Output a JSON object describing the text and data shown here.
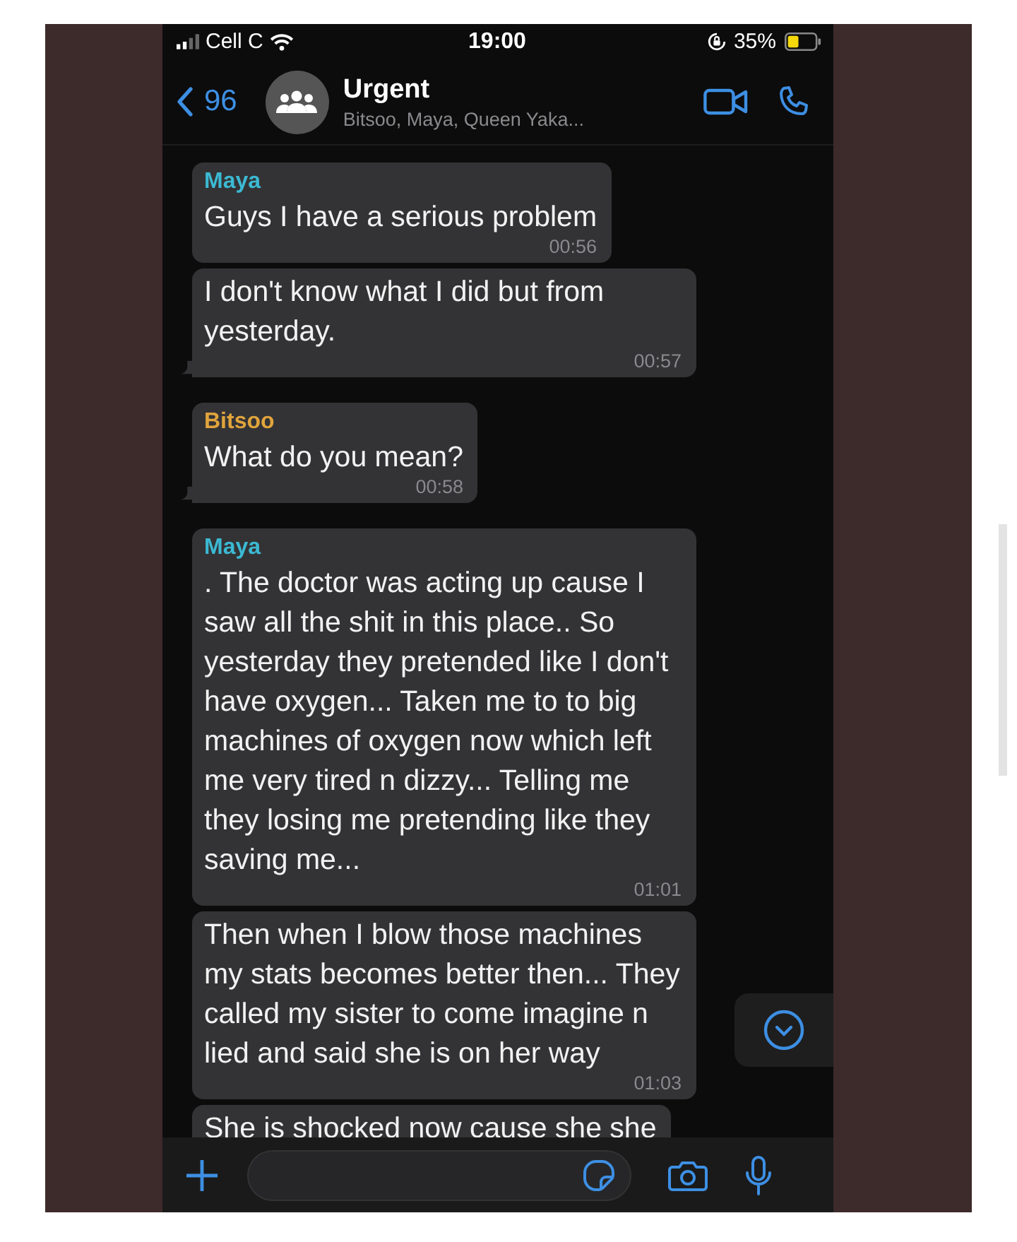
{
  "status_bar": {
    "carrier": "Cell C",
    "time": "19:00",
    "battery": "35%"
  },
  "header": {
    "back_count": "96",
    "title": "Urgent",
    "subtitle": "Bitsoo, Maya, Queen Yaka..."
  },
  "messages": [
    {
      "sender": "Maya",
      "color": "#3cb9d3",
      "text": "Guys I have a serious problem",
      "time": "00:56",
      "tail": false
    },
    {
      "text": "I don't know what I did but from yesterday.",
      "time": "00:57",
      "tail": true
    },
    {
      "sender": "Bitsoo",
      "color": "#e0a43c",
      "text": "What do you mean?",
      "time": "00:58",
      "tail": true
    },
    {
      "sender": "Maya",
      "color": "#3cb9d3",
      "text": ". The doctor was acting up cause I saw all the shit in this place.. So yesterday they pretended like I don't have oxygen... Taken me to to big machines of oxygen now which left me very tired n dizzy... Telling me they losing me pretending like they saving me...",
      "time": "01:01",
      "tail": false
    },
    {
      "text": "Then when I blow those machines my stats becomes better then... They called my sister to come imagine n lied and said she is on her way",
      "time": "01:03",
      "tail": false
    },
    {
      "text": "She is shocked now cause she she",
      "tail": false
    }
  ]
}
